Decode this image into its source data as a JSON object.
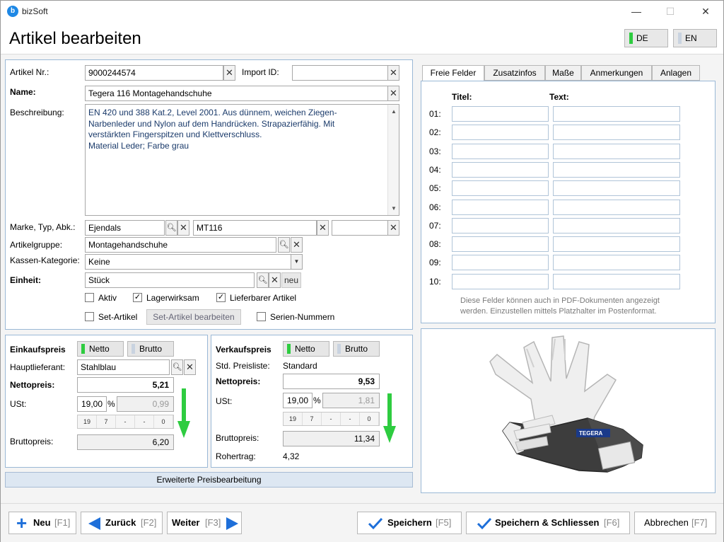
{
  "app": {
    "name": "bizSoft",
    "logo_letter": "b",
    "title": "Artikel bearbeiten"
  },
  "window": {
    "minimize": "—",
    "maximize": "☐",
    "close": "✕"
  },
  "lang": {
    "de": "DE",
    "en": "EN",
    "active_color": "#2ecc40"
  },
  "form": {
    "artikel_nr_label": "Artikel Nr.:",
    "artikel_nr": "9000244574",
    "import_id_label": "Import ID:",
    "import_id": "",
    "name_label": "Name:",
    "name": "Tegera 116 Montagehandschuhe",
    "beschreibung_label": "Beschreibung:",
    "beschreibung_lines": [
      "EN 420 und 388 Kat.2, Level 2001. Aus dünnem, weichen Ziegen-",
      "Narbenleder und Nylon auf dem Handrücken. Strapazierfähig. Mit",
      "verstärkten Fingerspitzen und Klettverschluss.",
      "Material Leder; Farbe grau"
    ],
    "marke_label": "Marke, Typ, Abk.:",
    "marke": "Ejendals",
    "typ": "MT116",
    "abk": "",
    "artikelgruppe_label": "Artikelgruppe:",
    "artikelgruppe": "Montagehandschuhe",
    "kassen_label": "Kassen-Kategorie:",
    "kassen": "Keine",
    "einheit_label": "Einheit:",
    "einheit": "Stück",
    "neu_label": "neu",
    "aktiv_label": "Aktiv",
    "aktiv_checked": false,
    "lagerwirksam_label": "Lagerwirksam",
    "lagerwirksam_checked": true,
    "lieferbar_label": "Lieferbarer Artikel",
    "lieferbar_checked": true,
    "set_label": "Set-Artikel",
    "set_checked": false,
    "set_edit_label": "Set-Artikel bearbeiten",
    "serien_label": "Serien-Nummern",
    "serien_checked": false
  },
  "einkauf": {
    "title": "Einkaufspreis",
    "netto": "Netto",
    "brutto": "Brutto",
    "lieferant_label": "Hauptlieferant:",
    "lieferant": "Stahlblau",
    "nettopreis_label": "Nettopreis:",
    "nettopreis": "5,21",
    "ust_label": "USt:",
    "ust": "19,00",
    "pct": "%",
    "ust_betrag": "0,99",
    "tax_buttons": [
      "19",
      "7",
      "-",
      "-",
      "0"
    ],
    "brutto_label": "Bruttopreis:",
    "bruttopreis": "6,20"
  },
  "verkauf": {
    "title": "Verkaufspreis",
    "netto": "Netto",
    "brutto": "Brutto",
    "preisliste_label": "Std. Preisliste:",
    "preisliste": "Standard",
    "nettopreis_label": "Nettopreis:",
    "nettopreis": "9,53",
    "ust_label": "USt:",
    "ust": "19,00",
    "pct": "%",
    "ust_betrag": "1,81",
    "tax_buttons": [
      "19",
      "7",
      "-",
      "-",
      "0"
    ],
    "brutto_label": "Bruttopreis:",
    "bruttopreis": "11,34",
    "rohertrag_label": "Rohertrag:",
    "rohertrag": "4,32"
  },
  "erweitert_label": "Erweiterte Preisbearbeitung",
  "tabs": [
    "Freie Felder",
    "Zusatzinfos",
    "Maße",
    "Anmerkungen",
    "Anlagen"
  ],
  "freie": {
    "titel_header": "Titel:",
    "text_header": "Text:",
    "rows": [
      "01:",
      "02:",
      "03:",
      "04:",
      "05:",
      "06:",
      "07:",
      "08:",
      "09:",
      "10:"
    ],
    "hint_line1": "Diese Felder können auch in PDF-Dokumenten angezeigt",
    "hint_line2": "werden. Einzustellen mittels Platzhalter im Postenformat."
  },
  "product_brand": "TEGERA",
  "footer": {
    "neu": "Neu",
    "neu_key": "[F1]",
    "zurueck": "Zurück",
    "zurueck_key": "[F2]",
    "weiter": "Weiter",
    "weiter_key": "[F3]",
    "speichern": "Speichern",
    "speichern_key": "[F5]",
    "speichern_schliessen": "Speichern & Schliessen",
    "speichern_schliessen_key": "[F6]",
    "abbrechen": "Abbrechen",
    "abbrechen_key": "[F7]"
  },
  "colors": {
    "accent_blue": "#1e6fd9",
    "green": "#2ecc40",
    "arrow_green": "#2ecc40"
  }
}
